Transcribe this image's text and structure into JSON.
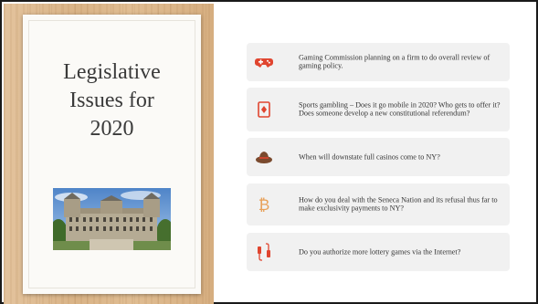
{
  "slide": {
    "title_lines": [
      "Legislative",
      "Issues for",
      "2020"
    ]
  },
  "items": [
    {
      "icon": "game-controller-icon",
      "text": "Gaming Commission planning on a firm to do overall review of gaming policy."
    },
    {
      "icon": "playing-card-icon",
      "text": "Sports gambling – Does it go mobile in 2020? Who gets to offer it? Does someone develop a new constitutional referendum?"
    },
    {
      "icon": "cowboy-hat-icon",
      "text": "When will downstate full casinos come to NY?"
    },
    {
      "icon": "bitcoin-icon",
      "text": "How do you deal with the Seneca Nation and its refusal thus far to make exclusivity payments to NY?"
    },
    {
      "icon": "cable-plug-icon",
      "text": "Do you authorize more lottery games via the Internet?"
    }
  ],
  "colors": {
    "accent_red": "#e0452f",
    "accent_orange": "#e8a15a",
    "card_bg": "#f1f1f1",
    "wood": "#dcb88c"
  }
}
